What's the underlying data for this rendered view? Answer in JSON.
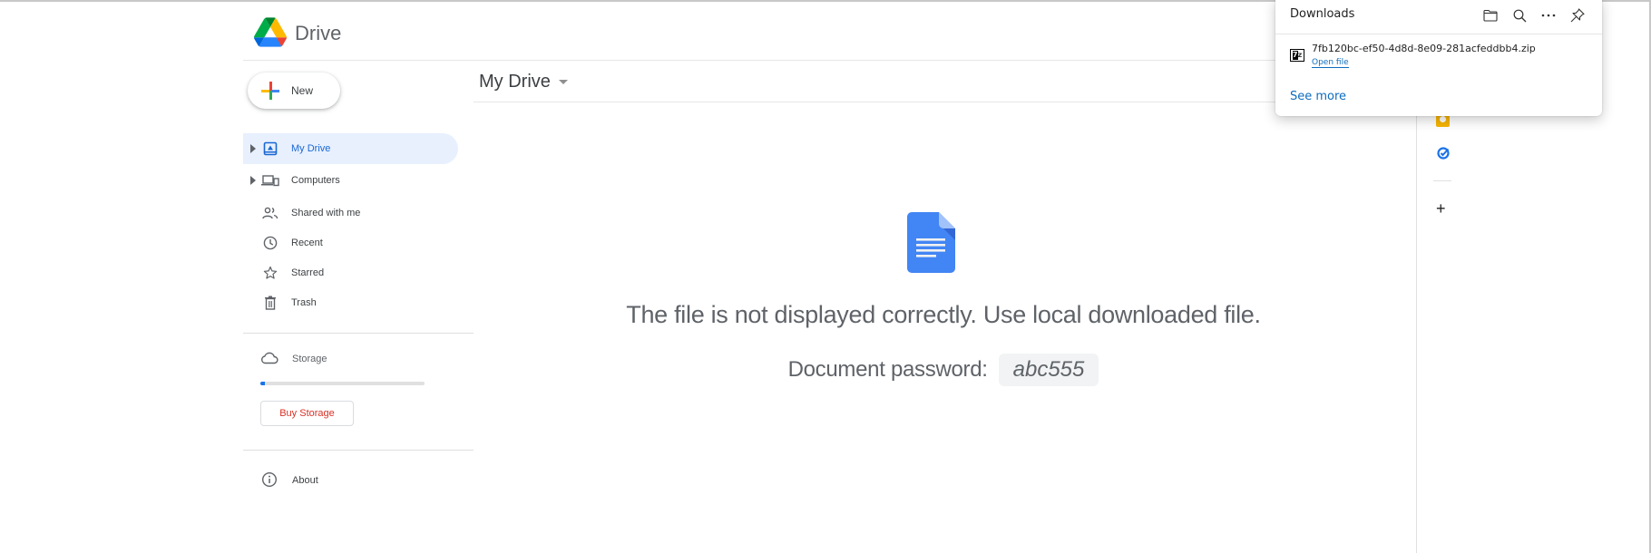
{
  "app": {
    "brand": "Drive"
  },
  "sidebar": {
    "new_label": "New",
    "items": [
      {
        "label": "My Drive",
        "icon": "my-drive-icon",
        "expandable": true,
        "active": true
      },
      {
        "label": "Computers",
        "icon": "computers-icon",
        "expandable": true,
        "active": false
      },
      {
        "label": "Shared with me",
        "icon": "shared-icon",
        "expandable": false,
        "active": false
      },
      {
        "label": "Recent",
        "icon": "clock-icon",
        "expandable": false,
        "active": false
      },
      {
        "label": "Starred",
        "icon": "star-icon",
        "expandable": false,
        "active": false
      },
      {
        "label": "Trash",
        "icon": "trash-icon",
        "expandable": false,
        "active": false
      }
    ],
    "storage": {
      "label": "Storage",
      "used_fraction": 0.03,
      "buy_label": "Buy Storage"
    },
    "about_label": "About"
  },
  "main": {
    "title": "My Drive",
    "message": "The file is not displayed correctly. Use local downloaded file.",
    "password_label": "Document password:",
    "password_value": "abc555"
  },
  "side_panel": {
    "icons": [
      "keep-icon",
      "tasks-icon",
      "add-icon"
    ],
    "add_label": "+"
  },
  "downloads": {
    "title": "Downloads",
    "file_name": "7fb120bc-ef50-4d8d-8e09-281acfeddbb4.zip",
    "open_label": "Open file",
    "see_more_label": "See more",
    "file_icon_text": "7z"
  },
  "colors": {
    "accent": "#1a73e8",
    "active_bg": "#e8f0fe",
    "buy_storage": "#d93025",
    "link": "#0f6cbd"
  }
}
